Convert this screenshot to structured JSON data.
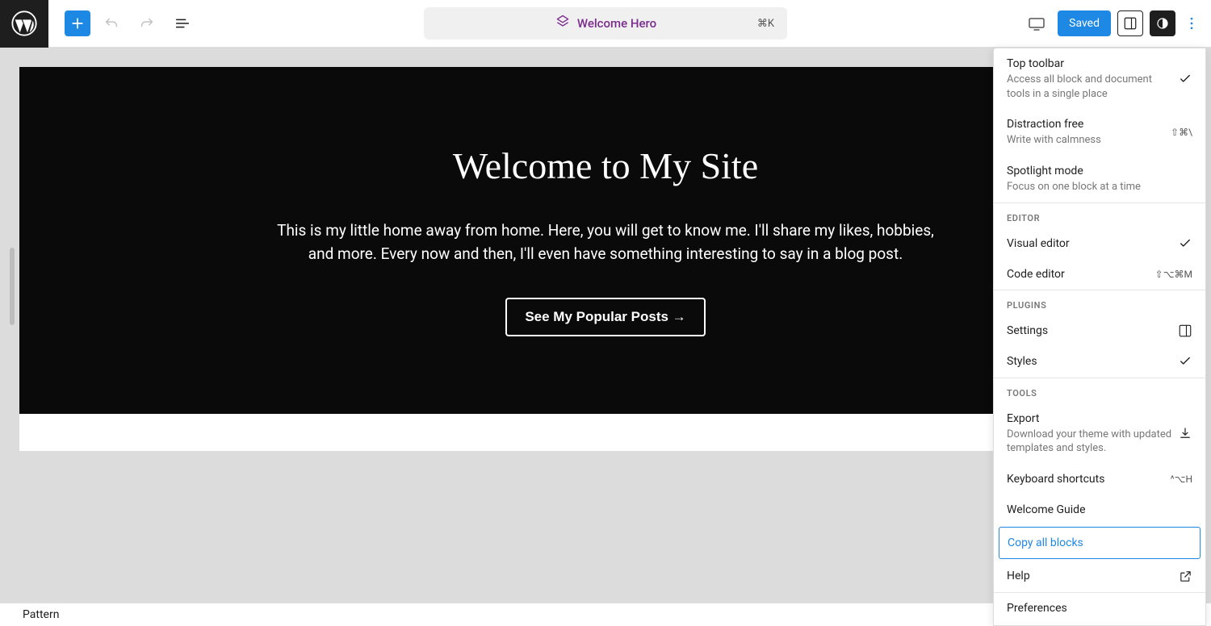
{
  "header": {
    "document_title": "Welcome Hero",
    "shortcut": "⌘K",
    "saved_label": "Saved"
  },
  "hero": {
    "title": "Welcome to My Site",
    "body": "This is my little home away from home. Here, you will get to know me. I'll share my likes, hobbies, and more. Every now and then, I'll even have something interesting to say in a blog post.",
    "button_label": "See My Popular Posts →"
  },
  "footer": {
    "type_label": "Pattern"
  },
  "panel": {
    "view": [
      {
        "title": "Top toolbar",
        "desc": "Access all block and document tools in a single place",
        "checked": true
      },
      {
        "title": "Distraction free",
        "desc": "Write with calmness",
        "shortcut": "⇧⌘\\"
      },
      {
        "title": "Spotlight mode",
        "desc": "Focus on one block at a time"
      }
    ],
    "group_editor": "Editor",
    "editor": [
      {
        "title": "Visual editor",
        "checked": true
      },
      {
        "title": "Code editor",
        "shortcut": "⇧⌥⌘M"
      }
    ],
    "group_plugins": "Plugins",
    "plugins": [
      {
        "title": "Settings",
        "icon": "panel"
      },
      {
        "title": "Styles",
        "checked": true
      }
    ],
    "group_tools": "Tools",
    "tools_export": {
      "title": "Export",
      "desc": "Download your theme with updated templates and styles."
    },
    "tools_shortcuts": {
      "title": "Keyboard shortcuts",
      "shortcut": "^⌥H"
    },
    "tools_welcome": {
      "title": "Welcome Guide"
    },
    "tools_copy": {
      "title": "Copy all blocks"
    },
    "tools_help": {
      "title": "Help"
    },
    "preferences": {
      "title": "Preferences"
    }
  }
}
